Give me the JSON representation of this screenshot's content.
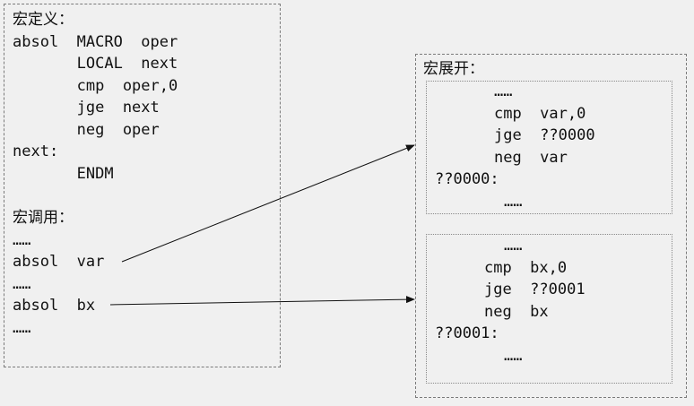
{
  "definition": {
    "heading": "宏定义：",
    "lines": [
      "absol  MACRO  oper",
      "       LOCAL  next",
      "       cmp  oper,0",
      "       jge  next",
      "       neg  oper",
      "next:",
      "       ENDM"
    ]
  },
  "invocation": {
    "heading": "宏调用：",
    "ellipsis": "……",
    "call1": "absol  var",
    "call2": "absol  bx"
  },
  "expansion": {
    "heading": "宏展开：",
    "block1": {
      "top_ellipsis": "……",
      "line1": "cmp  var,0",
      "line2": "jge  ??0000",
      "line3": "neg  var",
      "label": "??0000:",
      "bottom_ellipsis": "……"
    },
    "block2": {
      "top_ellipsis": "……",
      "line1": "cmp  bx,0",
      "line2": "jge  ??0001",
      "line3": "neg  bx",
      "label": "??0001:",
      "bottom_ellipsis": "……"
    }
  },
  "colors": {
    "background": "#f0f0f0",
    "border": "#7a7a7a",
    "text": "#111111"
  }
}
